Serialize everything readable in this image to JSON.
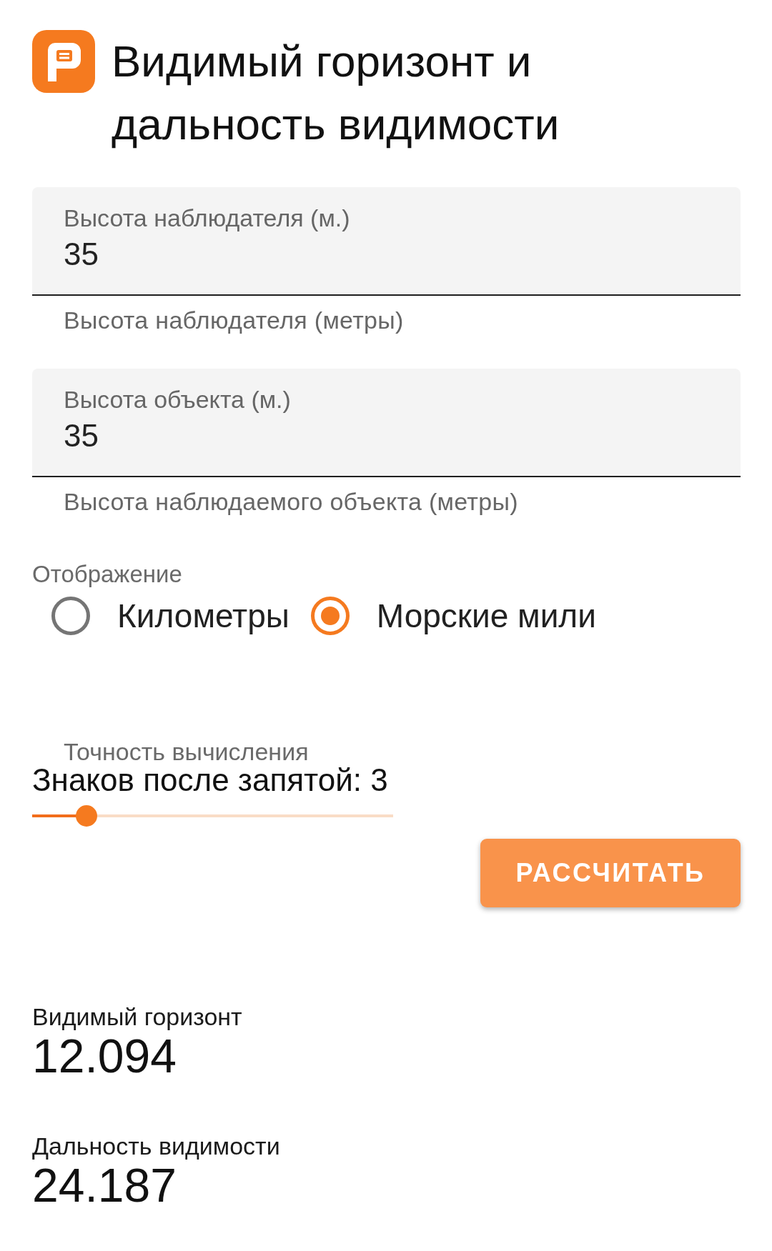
{
  "header": {
    "title": "Видимый горизонт и дальность видимости"
  },
  "fields": [
    {
      "label": "Высота наблюдателя (м.)",
      "value": "35",
      "helper": "Высота наблюдателя (метры)"
    },
    {
      "label": "Высота объекта (м.)",
      "value": "35",
      "helper": "Высота наблюдаемого объекта (метры)"
    }
  ],
  "display": {
    "label": "Отображение",
    "options": [
      {
        "label": "Километры",
        "selected": false
      },
      {
        "label": "Морские мили",
        "selected": true
      }
    ]
  },
  "precision": {
    "label": "Точность вычисления",
    "value_label": "Знаков после запятой: 3",
    "level": 0.15
  },
  "button": {
    "label": "РАССЧИТАТЬ"
  },
  "results": [
    {
      "label": "Видимый горизонт",
      "value": "12.094"
    },
    {
      "label": "Дальность видимости",
      "value": "24.187"
    }
  ]
}
